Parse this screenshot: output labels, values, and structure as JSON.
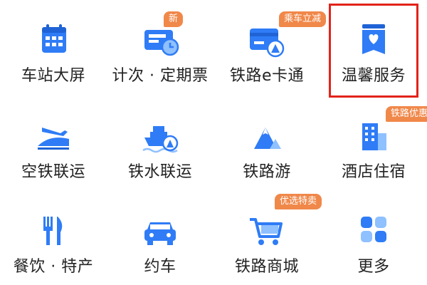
{
  "tiles": [
    {
      "label": "车站大屏",
      "icon": "calendar-icon"
    },
    {
      "label": "计次 · 定期票",
      "icon": "ticket-clock-icon",
      "badge": "新"
    },
    {
      "label": "铁路e卡通",
      "icon": "railcard-icon",
      "badge": "乘车立减"
    },
    {
      "label": "温馨服务",
      "icon": "heart-bag-icon",
      "highlighted": true
    },
    {
      "label": "空铁联运",
      "icon": "plane-train-icon"
    },
    {
      "label": "铁水联运",
      "icon": "ship-icon"
    },
    {
      "label": "铁路游",
      "icon": "mountain-icon"
    },
    {
      "label": "酒店住宿",
      "icon": "hotel-icon",
      "badge": "铁路优惠"
    },
    {
      "label": "餐饮 · 特产",
      "icon": "fork-knife-icon"
    },
    {
      "label": "约车",
      "icon": "car-icon"
    },
    {
      "label": "铁路商城",
      "icon": "shopping-cart-icon",
      "badge": "优选特卖"
    },
    {
      "label": "更多",
      "icon": "grid-more-icon"
    }
  ],
  "colors": {
    "blue": "#2f7cf6",
    "lightblue": "#8fc0ff",
    "badge": "#f0884a",
    "highlight": "#e2231a"
  }
}
